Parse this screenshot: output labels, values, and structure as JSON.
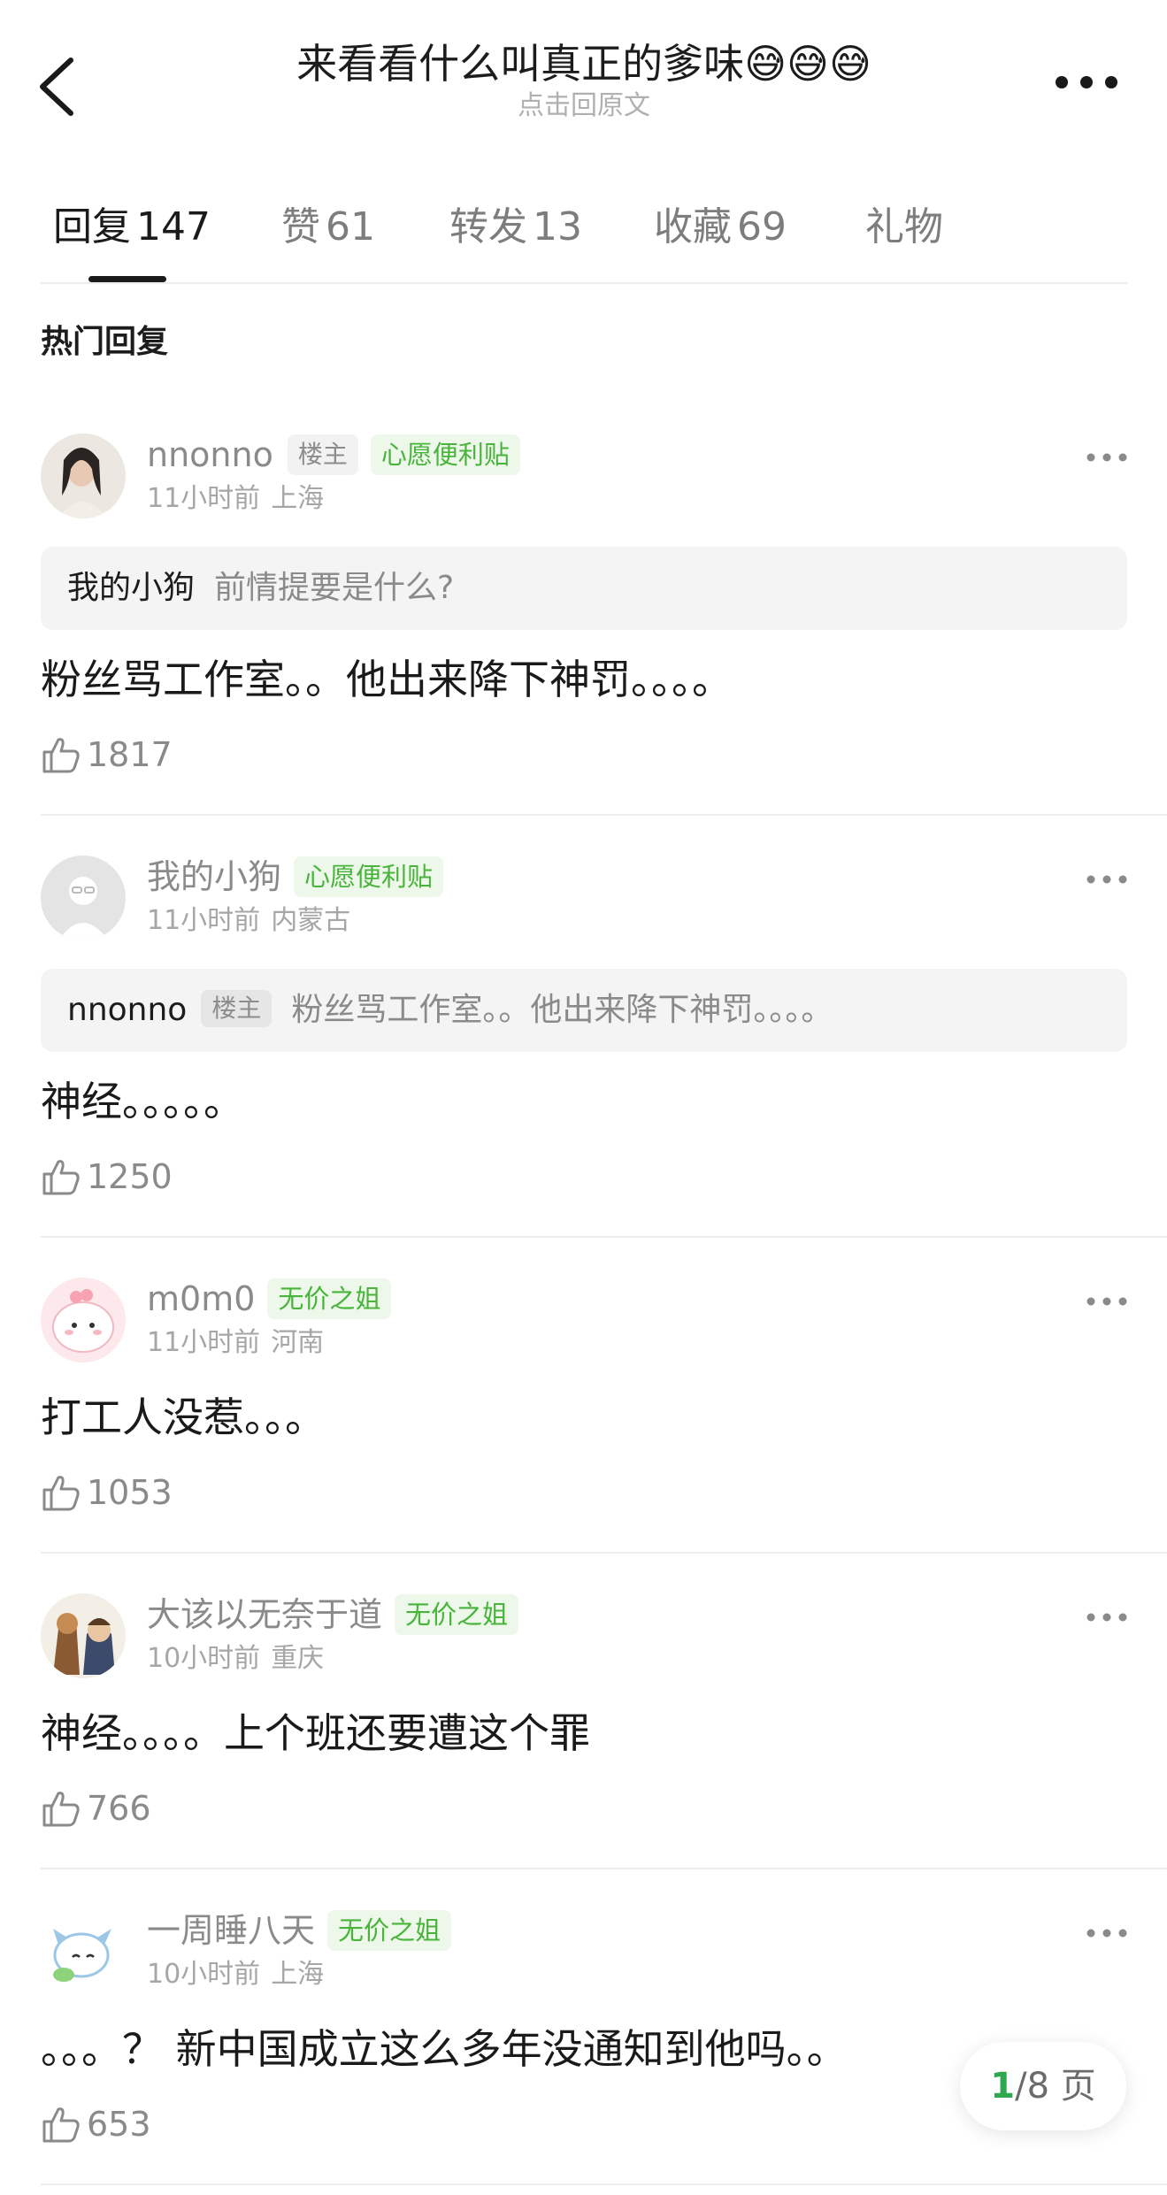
{
  "header": {
    "title": "来看看什么叫真正的爹味😅😅😅",
    "subtitle": "点击回原文"
  },
  "tabs": [
    {
      "label": "回复",
      "count": "147"
    },
    {
      "label": "赞",
      "count": "61"
    },
    {
      "label": "转发",
      "count": "13"
    },
    {
      "label": "收藏",
      "count": "69"
    },
    {
      "label": "礼物",
      "count": ""
    }
  ],
  "section_title": "热门回复",
  "comments": [
    {
      "username": "nnonno",
      "owner_badge": "楼主",
      "badge": "心愿便利贴",
      "time": "11小时前",
      "location": "上海",
      "quote": {
        "name": "我的小狗",
        "text": "前情提要是什么?"
      },
      "text": "粉丝骂工作室。。他出来降下神罚。。。。",
      "likes": "1817"
    },
    {
      "username": "我的小狗",
      "badge": "心愿便利贴",
      "time": "11小时前",
      "location": "内蒙古",
      "quote": {
        "name": "nnonno",
        "owner_badge": "楼主",
        "text": "粉丝骂工作室。。他出来降下神罚。。。。"
      },
      "text": "神经。。。。。",
      "likes": "1250"
    },
    {
      "username": "m0m0",
      "badge": "无价之姐",
      "time": "11小时前",
      "location": "河南",
      "text": "打工人没惹。。。",
      "likes": "1053"
    },
    {
      "username": "大该以无奈于道",
      "badge": "无价之姐",
      "time": "10小时前",
      "location": "重庆",
      "text": "神经。。。。上个班还要遭这个罪",
      "likes": "766"
    },
    {
      "username": "一周睡八天",
      "badge": "无价之姐",
      "time": "10小时前",
      "location": "上海",
      "text": "。。。？ 新中国成立这么多年没通知到他吗。。",
      "likes": "653"
    }
  ],
  "pager": {
    "current": "1",
    "total_label": "/8 页"
  },
  "colors": {
    "accent_green": "#48b43c",
    "pager_green": "#2fa84f",
    "quote_bg": "#f4f4f4"
  }
}
